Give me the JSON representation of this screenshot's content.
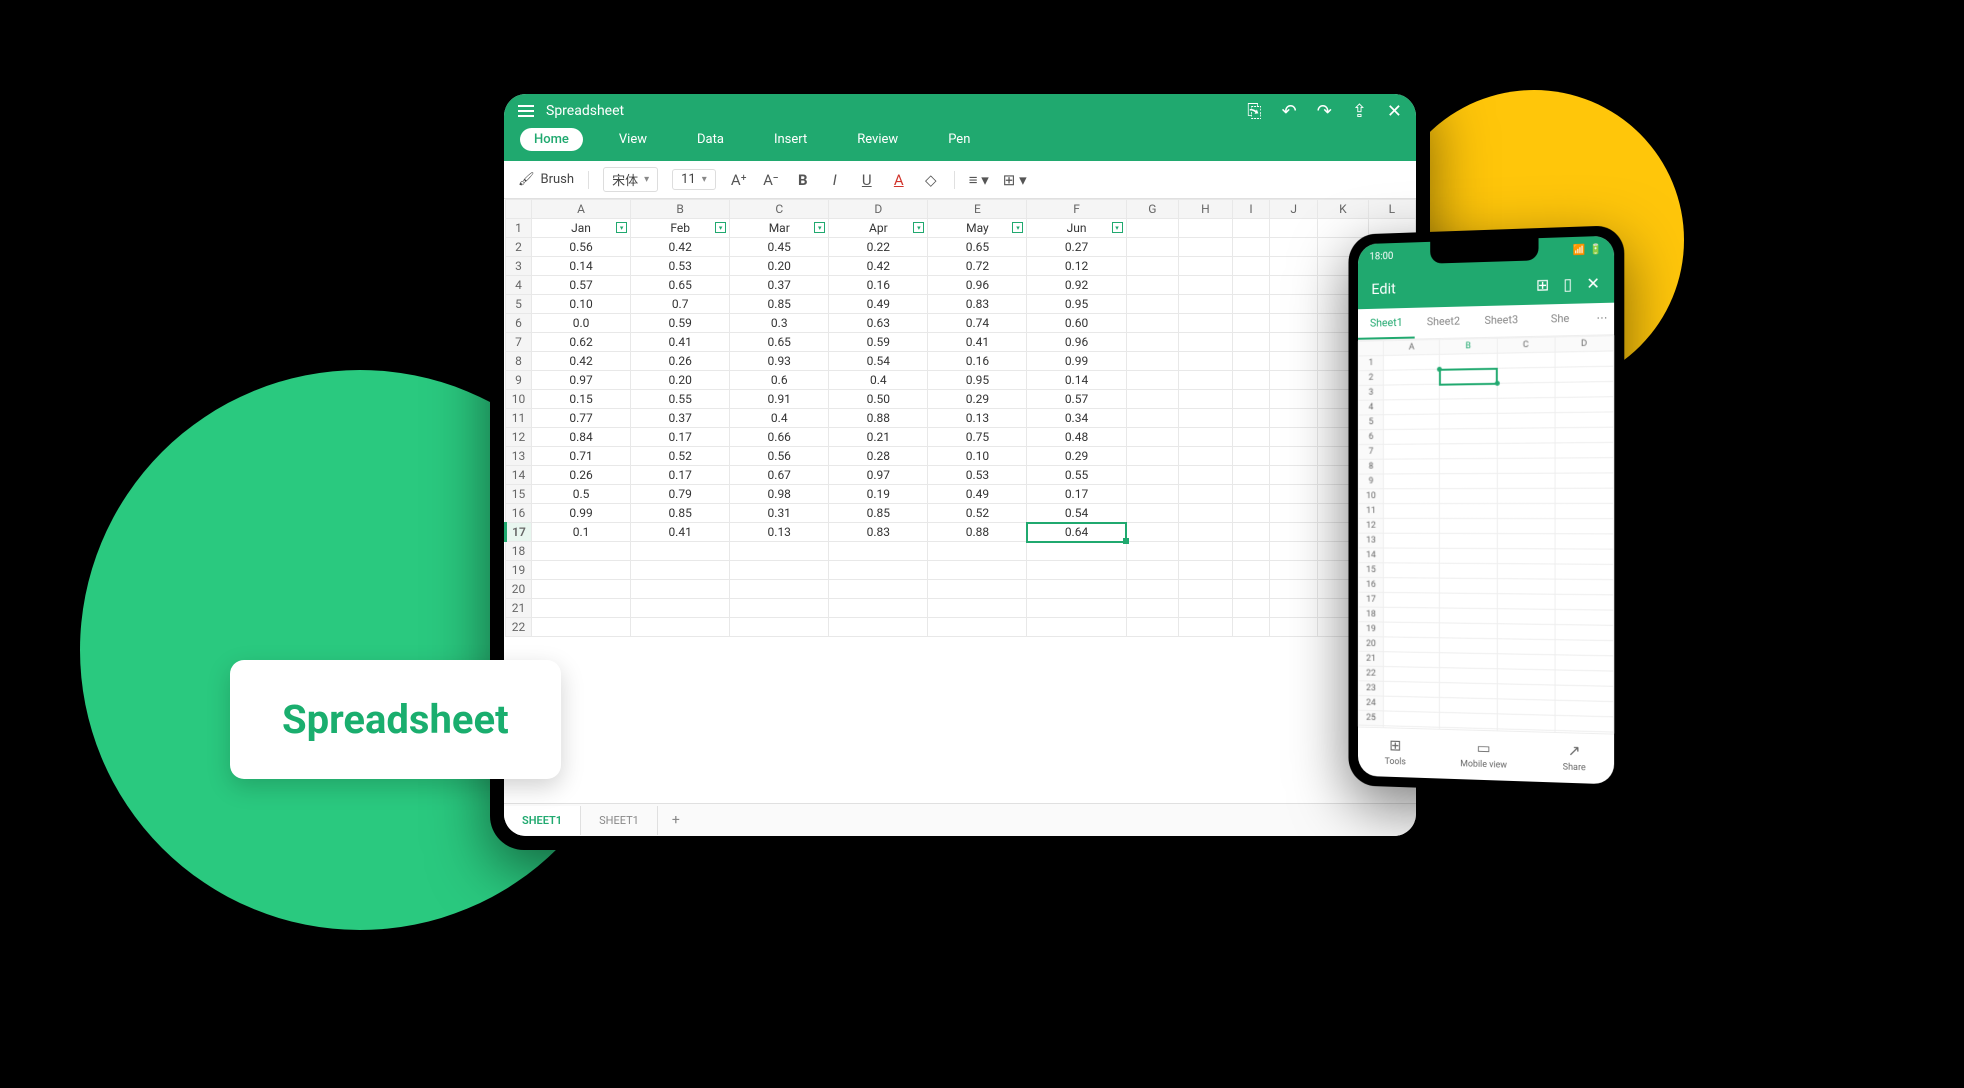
{
  "label_card": "Spreadsheet",
  "tablet": {
    "title": "Spreadsheet",
    "tabs": [
      "Home",
      "View",
      "Data",
      "Insert",
      "Review",
      "Pen"
    ],
    "active_tab": 0,
    "toolbar": {
      "brush": "Brush",
      "font_family": "宋体",
      "font_size": "11"
    },
    "col_letters": [
      "A",
      "B",
      "C",
      "D",
      "E",
      "F",
      "G",
      "H",
      "I",
      "J",
      "K",
      "L"
    ],
    "data_headers": [
      "Jan",
      "Feb",
      "Mar",
      "Apr",
      "May",
      "Jun"
    ],
    "selected": {
      "row": 17,
      "col": 5
    },
    "rows": [
      [
        "0.56",
        "0.42",
        "0.45",
        "0.22",
        "0.65",
        "0.27"
      ],
      [
        "0.14",
        "0.53",
        "0.20",
        "0.42",
        "0.72",
        "0.12"
      ],
      [
        "0.57",
        "0.65",
        "0.37",
        "0.16",
        "0.96",
        "0.92"
      ],
      [
        "0.10",
        "0.7",
        "0.85",
        "0.49",
        "0.83",
        "0.95"
      ],
      [
        "0.0",
        "0.59",
        "0.3",
        "0.63",
        "0.74",
        "0.60"
      ],
      [
        "0.62",
        "0.41",
        "0.65",
        "0.59",
        "0.41",
        "0.96"
      ],
      [
        "0.42",
        "0.26",
        "0.93",
        "0.54",
        "0.16",
        "0.99"
      ],
      [
        "0.97",
        "0.20",
        "0.6",
        "0.4",
        "0.95",
        "0.14"
      ],
      [
        "0.15",
        "0.55",
        "0.91",
        "0.50",
        "0.29",
        "0.57"
      ],
      [
        "0.77",
        "0.37",
        "0.4",
        "0.88",
        "0.13",
        "0.34"
      ],
      [
        "0.84",
        "0.17",
        "0.66",
        "0.21",
        "0.75",
        "0.48"
      ],
      [
        "0.71",
        "0.52",
        "0.56",
        "0.28",
        "0.10",
        "0.29"
      ],
      [
        "0.26",
        "0.17",
        "0.67",
        "0.97",
        "0.53",
        "0.55"
      ],
      [
        "0.5",
        "0.79",
        "0.98",
        "0.19",
        "0.49",
        "0.17"
      ],
      [
        "0.99",
        "0.85",
        "0.31",
        "0.85",
        "0.52",
        "0.54"
      ],
      [
        "0.1",
        "0.41",
        "0.13",
        "0.83",
        "0.88",
        "0.64"
      ]
    ],
    "empty_rows": 5,
    "sheet_tabs": [
      "SHEET1",
      "SHEET1"
    ],
    "active_sheet": 0
  },
  "phone": {
    "status_time": "18:00",
    "edit_label": "Edit",
    "sheets": [
      "Sheet1",
      "Sheet2",
      "Sheet3",
      "She"
    ],
    "active_sheet": 0,
    "col_letters": [
      "A",
      "B",
      "C",
      "D"
    ],
    "selected_col": 1,
    "selected_row": 2,
    "row_count": 28,
    "footer": [
      {
        "icon": "⊞",
        "label": "Tools"
      },
      {
        "icon": "▭",
        "label": "Mobile view"
      },
      {
        "icon": "↗",
        "label": "Share"
      }
    ]
  }
}
